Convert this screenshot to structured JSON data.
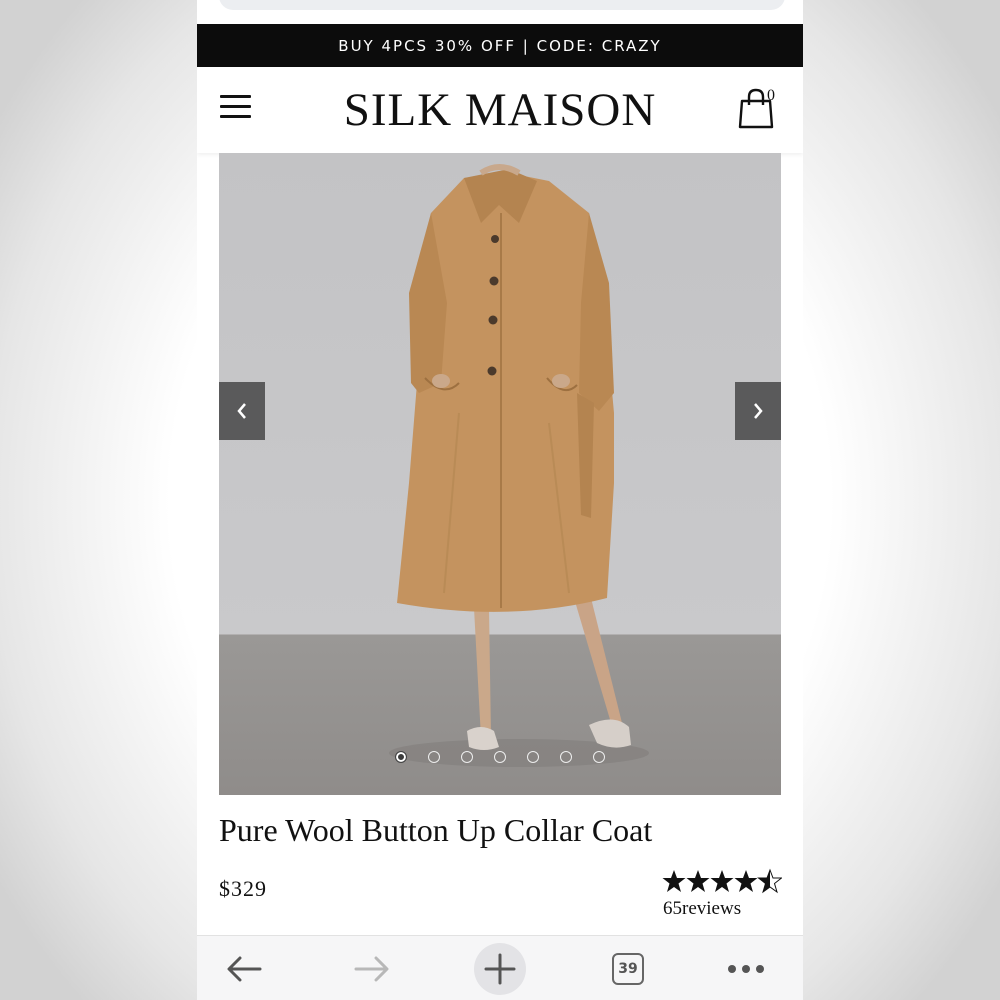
{
  "promo_banner": "BUY 4PCS 30% OFF | CODE: CRAZY",
  "header": {
    "menu_icon": "hamburger-menu-icon",
    "logo": "SILK MAISON",
    "cart_icon": "shopping-bag-icon",
    "cart_count": "0"
  },
  "gallery": {
    "prev_icon": "chevron-left-icon",
    "next_icon": "chevron-right-icon",
    "slide_count": 7,
    "active_slide": 1
  },
  "product": {
    "title": "Pure Wool Button Up Collar Coat",
    "price": "$329",
    "rating": 4.5,
    "reviews": "65reviews"
  },
  "browser_toolbar": {
    "back_icon": "arrow-left-icon",
    "forward_icon": "arrow-right-icon",
    "new_tab_icon": "plus-icon",
    "tab_count": "39",
    "more_icon": "more-dots-icon"
  },
  "colors": {
    "promo_bg": "#0c0c0c",
    "coat": "#c4935f",
    "text": "#111111"
  }
}
